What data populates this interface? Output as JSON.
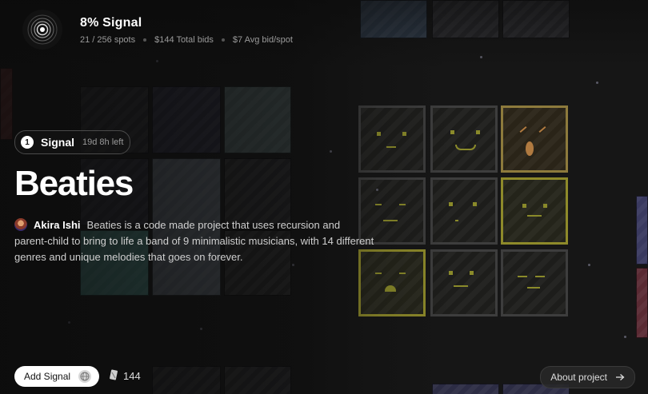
{
  "header": {
    "title": "8% Signal",
    "spots": "21 / 256 spots",
    "total_bids": "$144 Total bids",
    "avg_bid": "$7 Avg bid/spot",
    "logo_icon": "target-rings-icon"
  },
  "signal_badge": {
    "number": "1",
    "label": "Signal",
    "time_left": "19d 8h left"
  },
  "project": {
    "title": "Beaties",
    "author": "Akira Ishi",
    "description": "Beaties is a code made project that uses recursion and parent-child to bring to life a band of 9 minimalistic musicians, with 14 different genres and unique melodies that goes on forever."
  },
  "footer": {
    "add_signal_label": "Add Signal",
    "add_signal_icon": "globe-icon",
    "count_icon": "card-icon",
    "count": "144",
    "about_label": "About project",
    "about_icon": "arrow-right-icon"
  },
  "colors": {
    "background": "#161616",
    "accent_yellow": "#8e8a2a",
    "text_muted": "#9a9a9a"
  }
}
